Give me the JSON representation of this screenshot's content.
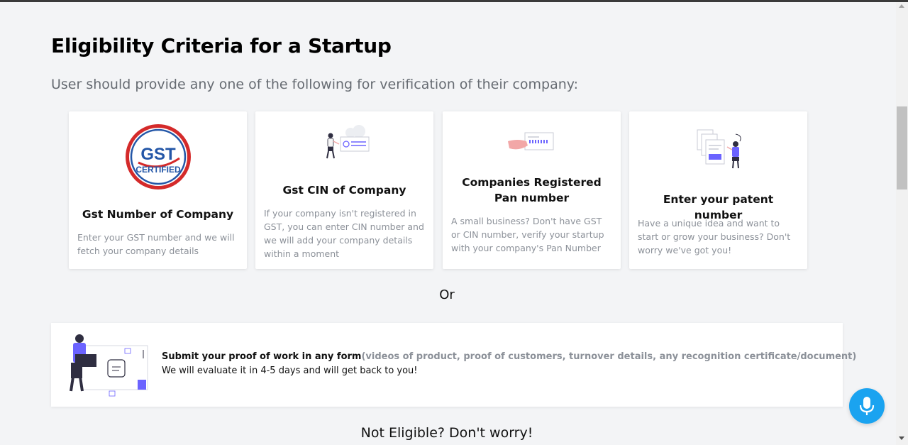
{
  "page": {
    "title": "Eligibility Criteria for a Startup",
    "subtitle": "User should provide any one of the following for verification of their company:"
  },
  "cards": [
    {
      "icon": "gst-certified-logo",
      "logo_text_top": "GST",
      "logo_text_bottom": "CERTIFIED",
      "title": "Gst Number of Company",
      "description": "Enter your GST number and we will fetch your company details"
    },
    {
      "icon": "cin-illustration",
      "title": "Gst CIN of Company",
      "description": "If your company isn't registered in GST, you can enter CIN number and we will add your company details within a moment"
    },
    {
      "icon": "pan-card-illustration",
      "title": "Companies Registered Pan number",
      "description": "A small business? Don't have GST or CIN number, verify your startup with your company's Pan Number"
    },
    {
      "icon": "patent-illustration",
      "title": "Enter your patent number",
      "description": "Have a unique idea and want to start or grow your business? Don't worry we've got you!"
    }
  ],
  "or_label": "Or",
  "proof": {
    "icon": "proof-of-work-illustration",
    "bold_text": "Submit your proof of work in any form",
    "muted_text": "(videos of product, proof of customers, turnover details, any recognition certificate/document)",
    "line2": "We will evaluate it in 4-5 days and will get back to you!"
  },
  "not_eligible": "Not Eligible? Don't worry!",
  "mic": {
    "icon": "microphone-icon"
  },
  "colors": {
    "accent_purple": "#6b63ff",
    "mic_blue": "#1aa3f0",
    "gst_red": "#d42a2a",
    "gst_blue": "#2356a7",
    "muted_text": "#8c9199"
  }
}
